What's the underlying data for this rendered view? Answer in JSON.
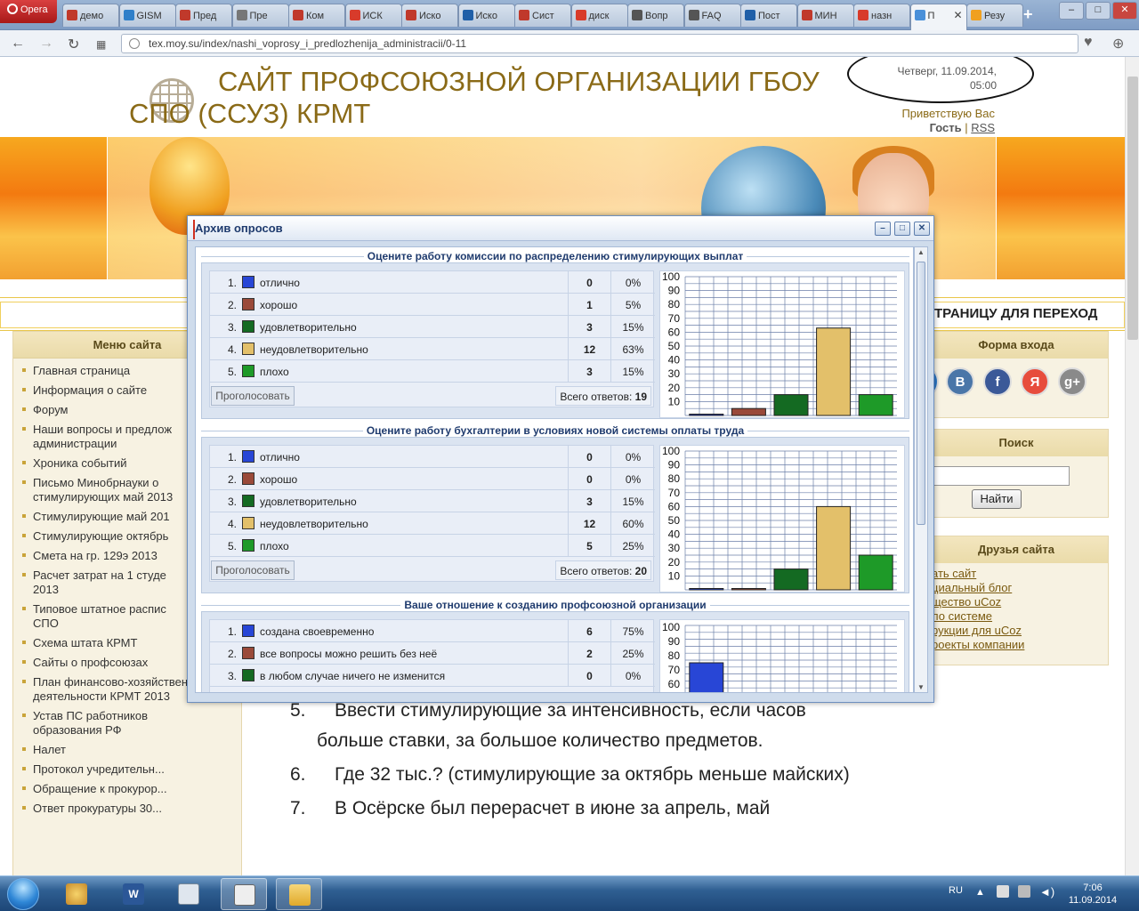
{
  "browser": {
    "menu_label": "Opera",
    "tabs": [
      {
        "label": "демо",
        "color": "#c0392b"
      },
      {
        "label": "GISM",
        "color": "#2f7fc9"
      },
      {
        "label": "Пред",
        "color": "#c0392b"
      },
      {
        "label": "Пре",
        "color": "#777777"
      },
      {
        "label": "Ком",
        "color": "#c0392b"
      },
      {
        "label": "ИСК",
        "color": "#d83b2b"
      },
      {
        "label": "Иско",
        "color": "#c0392b"
      },
      {
        "label": "Иско",
        "color": "#1f5fa8"
      },
      {
        "label": "Сист",
        "color": "#c0392b"
      },
      {
        "label": "диск",
        "color": "#d83b2b"
      },
      {
        "label": "Вопр",
        "color": "#555555"
      },
      {
        "label": "FAQ",
        "color": "#555555"
      },
      {
        "label": "Пост",
        "color": "#1f5fa8"
      },
      {
        "label": "МИН",
        "color": "#c0392b"
      },
      {
        "label": "назн",
        "color": "#d83b2b"
      },
      {
        "label": "П",
        "color": "#4a90d9"
      },
      {
        "label": "Резу",
        "color": "#f0a020"
      }
    ],
    "new_tab": "+",
    "url": "tex.moy.su/index/nashi_voprosy_i_predlozhenija_administracii/0-11"
  },
  "site": {
    "title": "САЙТ ПРОФСОЮЗНОЙ ОРГАНИЗАЦИИ ГБОУ СПО (ССУЗ) КРМТ",
    "date": "Четверг, 11.09.2014,",
    "time": "05:00",
    "greeting": "Приветствую Вас",
    "guest": "Гость",
    "rss": "RSS",
    "ticker": "ТРАНИЦУ ДЛЯ ПЕРЕХОД"
  },
  "left_menu": {
    "header": "Меню сайта",
    "items": [
      "Главная страница",
      "Информация о сайте",
      "Форум",
      "Наши вопросы и предлож\nадминистрации",
      "Хроника событий",
      "Письмо Минобрнауки о\nстимулирующих май 2013",
      "Стимулирующие май 201",
      "Стимулирующие октябрь",
      "Смета на гр. 129э 2013",
      "Расчет затрат на 1 студе\n2013",
      "Типовое штатное распис\nСПО",
      "Схема штата КРМТ",
      "Сайты о профсоюзах",
      "План финансово-хозяйственной\nдеятельности КРМТ 2013",
      "Устав ПС работников\nобразования РФ",
      "Налет",
      "Протокол учредительн...",
      "Обращение к прокурор...",
      "Ответ прокуратуры 30..."
    ]
  },
  "right": {
    "login_header": "Форма входа",
    "search_header": "Поиск",
    "search_button": "Найти",
    "friends_header": "Друзья сайта",
    "friends": [
      "ать сайт",
      "циальный блог",
      "щество uCoz",
      "ло системе",
      "рукции для uCoz",
      "роекты компании"
    ]
  },
  "article": {
    "items": [
      {
        "num": "5.",
        "text": "Ввести стимулирующие за интенсивность, если часов больше ставки, за большое количество предметов."
      },
      {
        "num": "6.",
        "text": "Где 32 тыс.? (стимулирующие за октябрь меньше майских)"
      },
      {
        "num": "7.",
        "text": "В Осёрске был перерасчет в июне за апрель, май"
      }
    ]
  },
  "dialog": {
    "title": "Архив опросов",
    "vote_label": "Проголосовать",
    "total_label": "Всего ответов:"
  },
  "chart_data": [
    {
      "type": "bar",
      "title": "Оцените работу комиссии по распределению стимулирующих выплат",
      "categories": [
        "отлично",
        "хорошо",
        "удовлетворительно",
        "неудовлетворительно",
        "плохо"
      ],
      "values": [
        0,
        1,
        3,
        12,
        3
      ],
      "percents": [
        "0%",
        "5%",
        "15%",
        "63%",
        "15%"
      ],
      "bar_percent": [
        0,
        5,
        15,
        63,
        15
      ],
      "colors": [
        "#2846d6",
        "#9a4a3a",
        "#146a22",
        "#e3c06a",
        "#1e9a28"
      ],
      "total": "19",
      "ylim": [
        0,
        100
      ],
      "yticks": [
        "10",
        "20",
        "30",
        "40",
        "50",
        "60",
        "70",
        "80",
        "90",
        "100"
      ]
    },
    {
      "type": "bar",
      "title": "Оцените работу бухгалтерии в условиях новой системы оплаты труда",
      "categories": [
        "отлично",
        "хорошо",
        "удовлетворительно",
        "неудовлетворительно",
        "плохо"
      ],
      "values": [
        0,
        0,
        3,
        12,
        5
      ],
      "percents": [
        "0%",
        "0%",
        "15%",
        "60%",
        "25%"
      ],
      "bar_percent": [
        0,
        0,
        15,
        60,
        25
      ],
      "colors": [
        "#2846d6",
        "#9a4a3a",
        "#146a22",
        "#e3c06a",
        "#1e9a28"
      ],
      "total": "20",
      "ylim": [
        0,
        100
      ],
      "yticks": [
        "10",
        "20",
        "30",
        "40",
        "50",
        "60",
        "70",
        "80",
        "90",
        "100"
      ]
    },
    {
      "type": "bar",
      "title": "Ваше отношение к созданию профсоюзной организации",
      "categories": [
        "создана своевременно",
        "все вопросы можно решить без неё",
        "в любом случае ничего не изменится"
      ],
      "values": [
        6,
        2,
        0
      ],
      "percents": [
        "75%",
        "25%",
        "0%"
      ],
      "bar_percent": [
        75,
        25,
        0
      ],
      "colors": [
        "#2846d6",
        "#9a4a3a",
        "#146a22"
      ],
      "total": "",
      "ylim": [
        0,
        100
      ],
      "yticks": [
        "60",
        "70",
        "80",
        "90",
        "100"
      ]
    }
  ],
  "taskbar": {
    "lang": "RU",
    "time": "7:06",
    "date": "11.09.2014"
  }
}
